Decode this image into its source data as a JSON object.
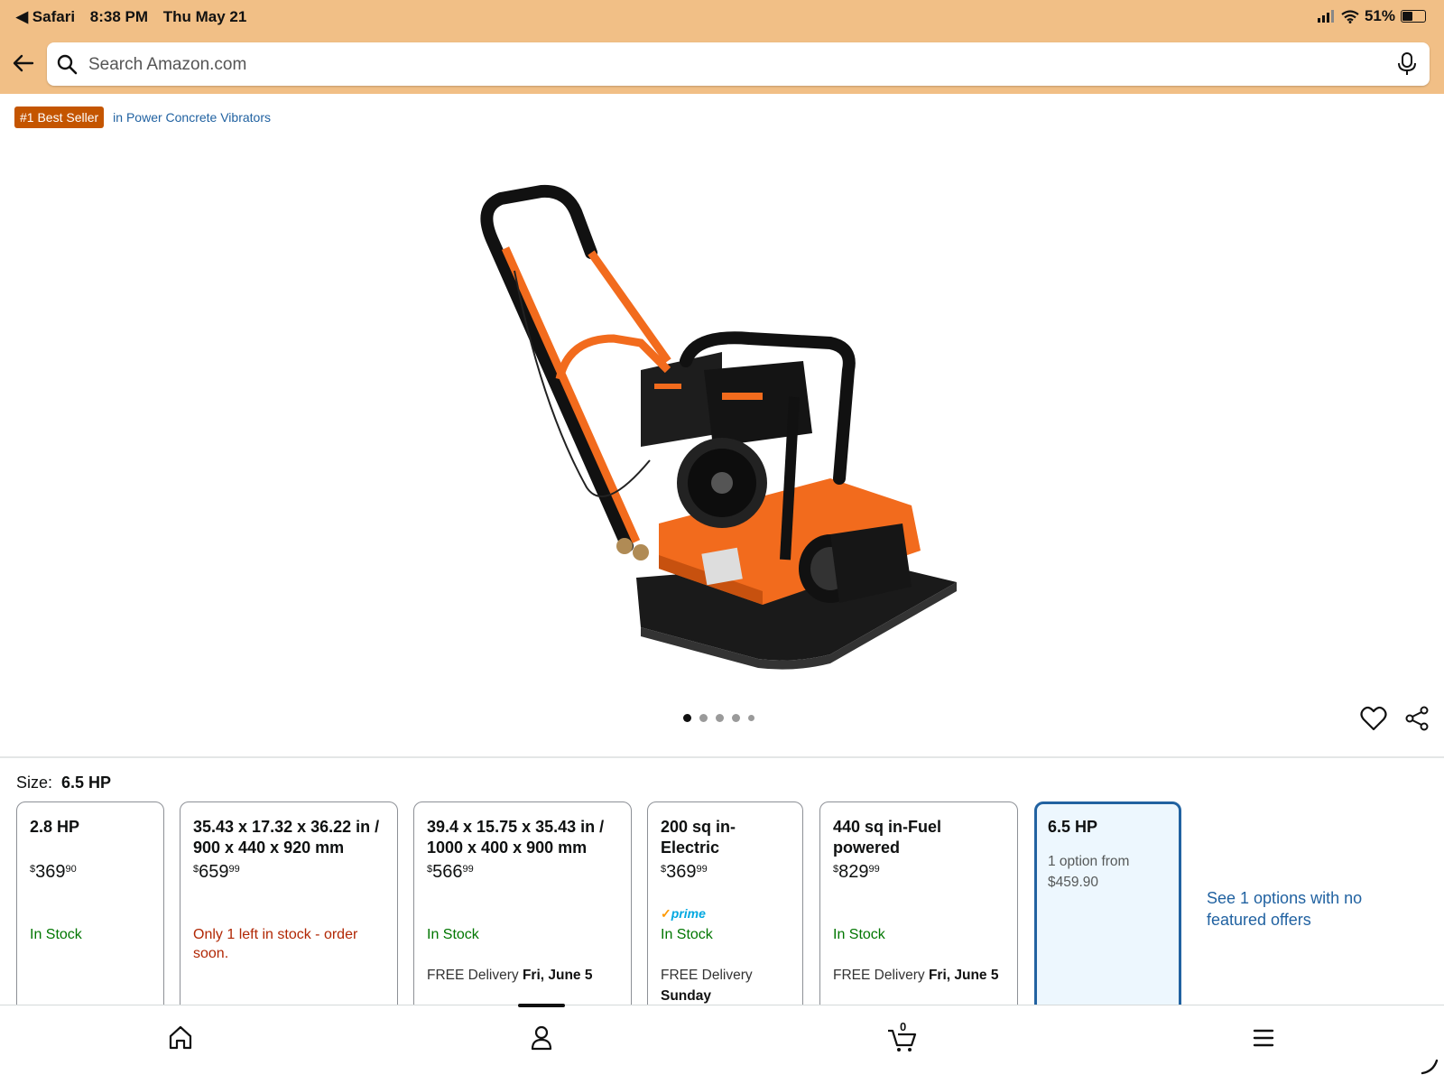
{
  "status_bar": {
    "back_app": "◀ Safari",
    "time": "8:38 PM",
    "date": "Thu May 21",
    "battery": "51%",
    "battery_level": 0.51
  },
  "search": {
    "placeholder": "Search Amazon.com"
  },
  "product": {
    "badge": "#1 Best Seller",
    "category": "in Power Concrete Vibrators",
    "image_count": 5,
    "active_image": 0
  },
  "size": {
    "label": "Size:",
    "selected": "6.5 HP",
    "options": [
      {
        "title": "2.8 HP",
        "price_whole": "369",
        "price_fraction": "90",
        "stock": "In Stock",
        "stock_color": "#007600",
        "delivery_prefix": "",
        "delivery_date": ""
      },
      {
        "title": "35.43 x 17.32 x 36.22 in / 900 x 440 x 920 mm",
        "price_whole": "659",
        "price_fraction": "99",
        "stock": "Only 1 left in stock - order soon.",
        "stock_color": "#b12704",
        "delivery_prefix": "",
        "delivery_date": ""
      },
      {
        "title": "39.4 x 15.75 x 35.43 in / 1000 x 400 x 900 mm",
        "price_whole": "566",
        "price_fraction": "99",
        "stock": "In Stock",
        "stock_color": "#007600",
        "delivery_prefix": "FREE Delivery",
        "delivery_date": "Fri, June 5"
      },
      {
        "title": "200 sq in-Electric",
        "price_whole": "369",
        "price_fraction": "99",
        "prime": "prime",
        "stock": "In Stock",
        "stock_color": "#007600",
        "delivery_prefix": "FREE Delivery",
        "delivery_date": "Sunday"
      },
      {
        "title": "440 sq in-Fuel powered",
        "price_whole": "829",
        "price_fraction": "99",
        "stock": "In Stock",
        "stock_color": "#007600",
        "delivery_prefix": "FREE Delivery",
        "delivery_date": "Fri, June 5"
      }
    ],
    "selected_card": {
      "title": "6.5 HP",
      "offer_line1": "1 option from",
      "offer_line2": "$459.90"
    },
    "see_options": "See 1 options with no featured offers"
  },
  "bottom_nav": {
    "cart_count": "0",
    "items": [
      "home-icon",
      "account-icon",
      "cart-icon",
      "menu-icon"
    ]
  },
  "colors": {
    "header_bg": "#f1bf86",
    "badge_bg": "#c45500",
    "link": "#2162a1",
    "in_stock": "#007600",
    "low_stock": "#b12704",
    "selected_border": "#2162a1",
    "selected_bg": "#edf7fe"
  }
}
